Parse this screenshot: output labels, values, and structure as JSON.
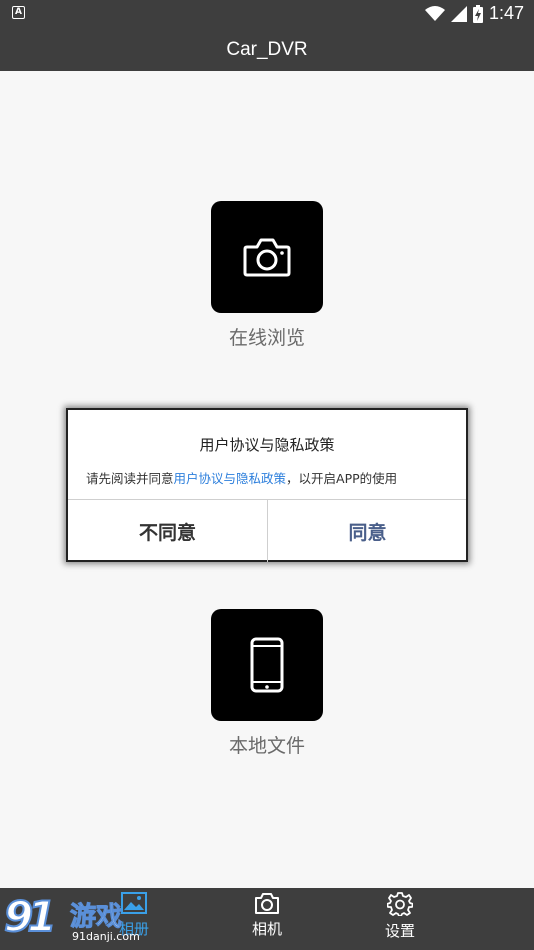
{
  "status_bar": {
    "notification_icon": "A",
    "time": "1:47",
    "icons": [
      "wifi-icon",
      "signal-icon",
      "battery-icon"
    ]
  },
  "app_bar": {
    "title": "Car_DVR"
  },
  "tiles": {
    "online": {
      "label": "在线浏览",
      "icon": "camera-icon"
    },
    "local": {
      "label": "本地文件",
      "icon": "phone-icon"
    }
  },
  "dialog": {
    "title": "用户协议与隐私政策",
    "message_prefix": "请先阅读并同意",
    "message_link": "用户协议与隐私政策",
    "message_suffix": "，以开启APP的使用",
    "disagree_label": "不同意",
    "agree_label": "同意",
    "link_color": "#2d7fdc"
  },
  "bottom_nav": {
    "items": [
      {
        "label": "相册",
        "icon": "gallery-icon",
        "active": true
      },
      {
        "label": "相机",
        "icon": "camera-icon",
        "active": false
      },
      {
        "label": "设置",
        "icon": "gear-icon",
        "active": false
      }
    ]
  },
  "watermark": {
    "brand": "9",
    "brand2": "1",
    "name": "游戏",
    "site": "91danji.com"
  }
}
